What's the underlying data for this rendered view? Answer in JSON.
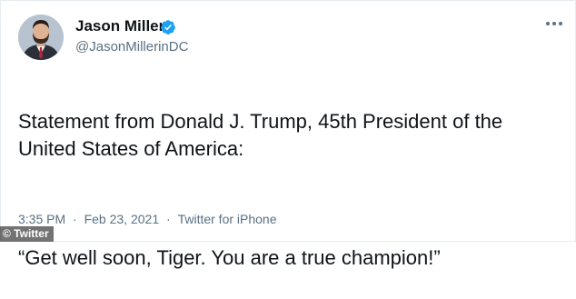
{
  "tweet": {
    "display_name": "Jason Miller",
    "handle": "@JasonMillerinDC",
    "verified": true,
    "text_line1": "Statement from Donald J. Trump, 45th President of the United States of America:",
    "text_line2": "“Get well soon, Tiger. You are a true champion!”",
    "time": "3:35 PM",
    "separator": "·",
    "date": "Feb 23, 2021",
    "source": "Twitter for iPhone",
    "more_icon": "more-horizontal-icon",
    "verified_icon": "verified-badge-icon"
  },
  "watermark": {
    "text": "© Twitter"
  },
  "colors": {
    "verified_blue": "#1da1f2",
    "secondary_text": "#5b7083",
    "primary_text": "#0f1419"
  }
}
